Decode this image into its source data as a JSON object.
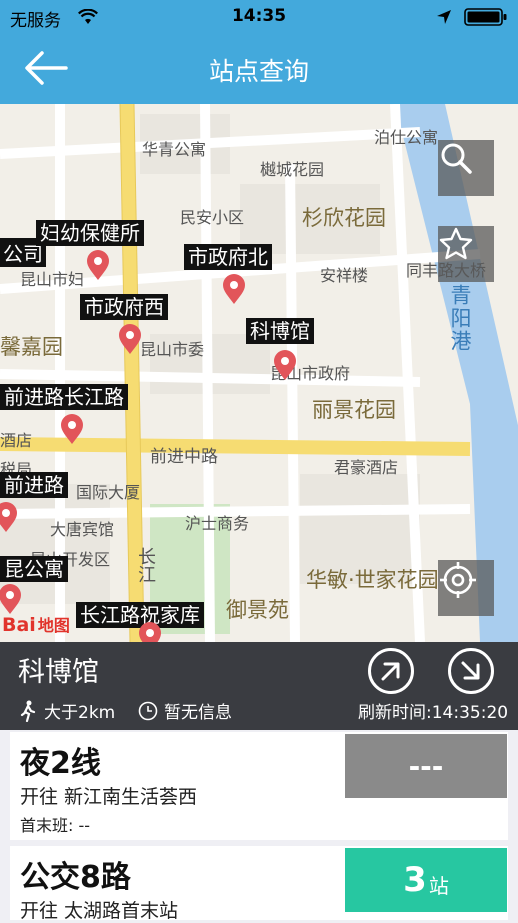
{
  "status_bar": {
    "carrier": "无服务",
    "time": "14:35"
  },
  "nav": {
    "title": "站点查询"
  },
  "map": {
    "places": [
      {
        "name": "华青公寓"
      },
      {
        "name": "泊仕公寓"
      },
      {
        "name": "樾城花园"
      },
      {
        "name": "民安小区"
      },
      {
        "name": "杉欣花园"
      },
      {
        "name": "安祥楼"
      },
      {
        "name": "同丰路大桥"
      },
      {
        "name": "昆山市妇"
      },
      {
        "name": "昆山市委"
      },
      {
        "name": "昆山市政府"
      },
      {
        "name": "丽景花园"
      },
      {
        "name": "馨嘉园"
      },
      {
        "name": "酒店"
      },
      {
        "name": "前进中路"
      },
      {
        "name": "君豪酒店"
      },
      {
        "name": "税局"
      },
      {
        "name": "国际大厦"
      },
      {
        "name": "大唐宾馆"
      },
      {
        "name": "沪士商务"
      },
      {
        "name": "昆山开发区"
      },
      {
        "name": "华敏·世家花园"
      },
      {
        "name": "御景苑"
      },
      {
        "name": "长江"
      },
      {
        "name": "青阳港"
      },
      {
        "name": "公司"
      }
    ],
    "stops": [
      {
        "name": "妇幼保健所"
      },
      {
        "name": "市政府北"
      },
      {
        "name": "市政府西"
      },
      {
        "name": "科博馆"
      },
      {
        "name": "前进路长江路"
      },
      {
        "name": "前进路"
      },
      {
        "name": "昆公寓"
      },
      {
        "name": "长江路祝家库"
      }
    ],
    "logo": {
      "bai": "Bai",
      "du": "地图"
    }
  },
  "station": {
    "name": "科博馆",
    "distance": "大于2km",
    "info": "暂无信息",
    "refresh": "刷新时间:14:35:20"
  },
  "routes": [
    {
      "name": "夜2线",
      "direction": "开往 新江南生活荟西",
      "first_last": "首末班: --",
      "eta": "---",
      "eta_color": "#8a8a8a"
    },
    {
      "name": "公交8路",
      "direction": "开往 太湖路首末站",
      "eta_num": "3",
      "eta_unit": "站",
      "eta_color": "#27c7a1"
    }
  ],
  "colors": {
    "accent": "#43a9dc",
    "bar": "#3a3c41",
    "pin": "#e2555a"
  }
}
